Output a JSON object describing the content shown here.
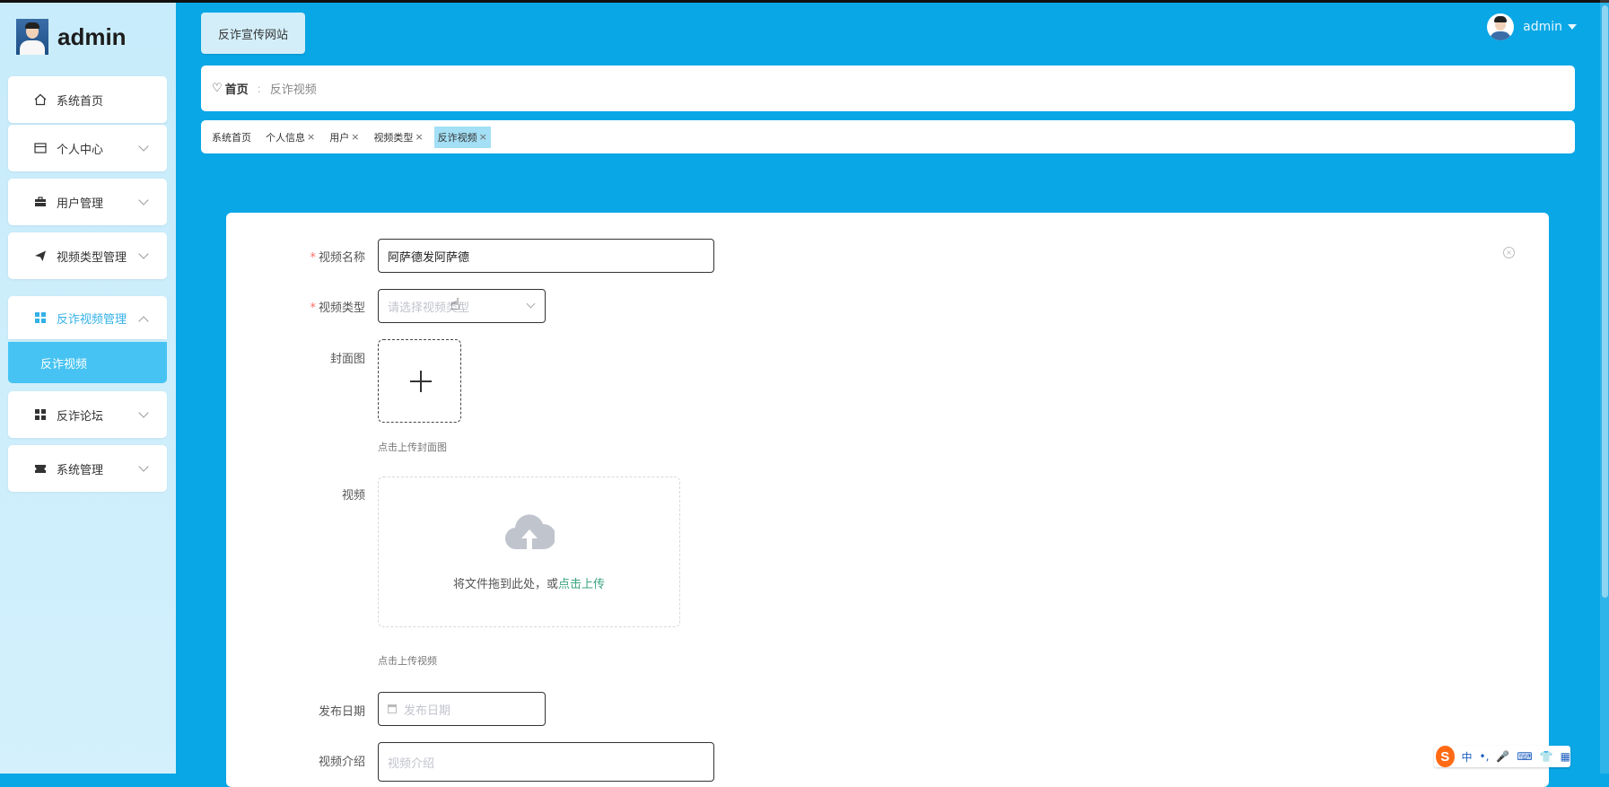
{
  "brand": {
    "name": "admin"
  },
  "sidebar": {
    "items": [
      {
        "label": "系统首页",
        "icon": "home-icon"
      },
      {
        "label": "个人中心",
        "icon": "card-icon"
      },
      {
        "label": "用户管理",
        "icon": "briefcase-icon"
      },
      {
        "label": "视频类型管理",
        "icon": "send-icon"
      },
      {
        "label": "反诈视频管理",
        "icon": "grid-icon",
        "active": true
      },
      {
        "label": "反诈论坛",
        "icon": "grid-icon"
      },
      {
        "label": "系统管理",
        "icon": "ticket-icon"
      }
    ],
    "submenu": {
      "label": "反诈视频"
    }
  },
  "header": {
    "site_button": "反诈宣传网站",
    "user": {
      "name": "admin"
    }
  },
  "breadcrumb": {
    "home": "首页",
    "separator": ":",
    "current": "反诈视频"
  },
  "tags": [
    {
      "label": "系统首页",
      "closable": false
    },
    {
      "label": "个人信息",
      "closable": true
    },
    {
      "label": "用户",
      "closable": true
    },
    {
      "label": "视频类型",
      "closable": true
    },
    {
      "label": "反诈视频",
      "closable": true,
      "active": true
    }
  ],
  "tag_close_symbol": "×",
  "form": {
    "video_name": {
      "label": "视频名称",
      "required_mark": "*",
      "value": "阿萨德发阿萨德"
    },
    "video_type": {
      "label": "视频类型",
      "required_mark": "*",
      "placeholder": "请选择视频类型"
    },
    "cover": {
      "label": "封面图",
      "hint": "点击上传封面图"
    },
    "video": {
      "label": "视频",
      "drag_text": "将文件拖到此处，或",
      "upload_link": "点击上传",
      "hint": "点击上传视频"
    },
    "publish_date": {
      "label": "发布日期",
      "placeholder": "发布日期"
    },
    "intro": {
      "label": "视频介绍",
      "placeholder": "视频介绍"
    }
  },
  "ime": {
    "logo": "S",
    "mode": "中",
    "items": [
      "•,",
      "🎤",
      "⌨",
      "👕",
      "▦"
    ]
  },
  "colors": {
    "accent": "#32b1e8",
    "background": "#0aa7e6",
    "required": "#f56c6c",
    "link": "#3aa37f"
  }
}
